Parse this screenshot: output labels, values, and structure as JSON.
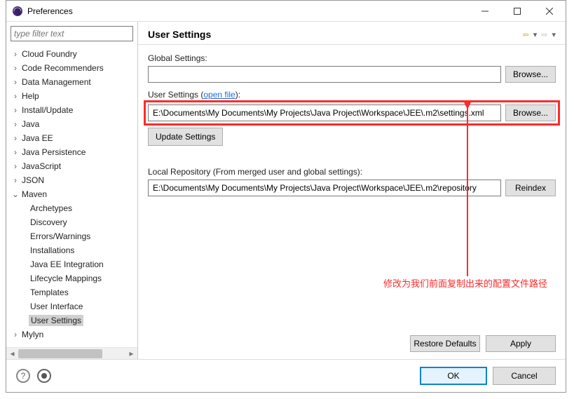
{
  "window": {
    "title": "Preferences"
  },
  "filter": {
    "placeholder": "type filter text"
  },
  "tree": {
    "items": [
      {
        "label": "Cloud Foundry",
        "expandable": true,
        "expanded": false,
        "level": 0
      },
      {
        "label": "Code Recommenders",
        "expandable": true,
        "expanded": false,
        "level": 0
      },
      {
        "label": "Data Management",
        "expandable": true,
        "expanded": false,
        "level": 0
      },
      {
        "label": "Help",
        "expandable": true,
        "expanded": false,
        "level": 0
      },
      {
        "label": "Install/Update",
        "expandable": true,
        "expanded": false,
        "level": 0
      },
      {
        "label": "Java",
        "expandable": true,
        "expanded": false,
        "level": 0
      },
      {
        "label": "Java EE",
        "expandable": true,
        "expanded": false,
        "level": 0
      },
      {
        "label": "Java Persistence",
        "expandable": true,
        "expanded": false,
        "level": 0
      },
      {
        "label": "JavaScript",
        "expandable": true,
        "expanded": false,
        "level": 0
      },
      {
        "label": "JSON",
        "expandable": true,
        "expanded": false,
        "level": 0
      },
      {
        "label": "Maven",
        "expandable": true,
        "expanded": true,
        "level": 0
      },
      {
        "label": "Archetypes",
        "expandable": false,
        "level": 1
      },
      {
        "label": "Discovery",
        "expandable": false,
        "level": 1
      },
      {
        "label": "Errors/Warnings",
        "expandable": false,
        "level": 1
      },
      {
        "label": "Installations",
        "expandable": false,
        "level": 1
      },
      {
        "label": "Java EE Integration",
        "expandable": false,
        "level": 1
      },
      {
        "label": "Lifecycle Mappings",
        "expandable": false,
        "level": 1
      },
      {
        "label": "Templates",
        "expandable": false,
        "level": 1
      },
      {
        "label": "User Interface",
        "expandable": false,
        "level": 1
      },
      {
        "label": "User Settings",
        "expandable": false,
        "level": 1,
        "selected": true
      },
      {
        "label": "Mylyn",
        "expandable": true,
        "expanded": false,
        "level": 0
      }
    ]
  },
  "page": {
    "title": "User Settings",
    "global_label": "Global Settings:",
    "global_value": "",
    "browse1": "Browse...",
    "user_label_prefix": "User Settings (",
    "user_label_link": "open file",
    "user_label_suffix": "):",
    "user_value": "E:\\Documents\\My Documents\\My Projects\\Java Project\\Workspace\\JEE\\.m2\\settings.xml",
    "browse2": "Browse...",
    "update_btn": "Update Settings",
    "local_label": "Local Repository (From merged user and global settings):",
    "local_value": "E:\\Documents\\My Documents\\My Projects\\Java Project\\Workspace\\JEE\\.m2\\repository",
    "reindex": "Reindex",
    "restore": "Restore Defaults",
    "apply": "Apply"
  },
  "footer": {
    "ok": "OK",
    "cancel": "Cancel"
  },
  "annotation": {
    "text": "修改为我们前面复制出来的配置文件路径"
  }
}
